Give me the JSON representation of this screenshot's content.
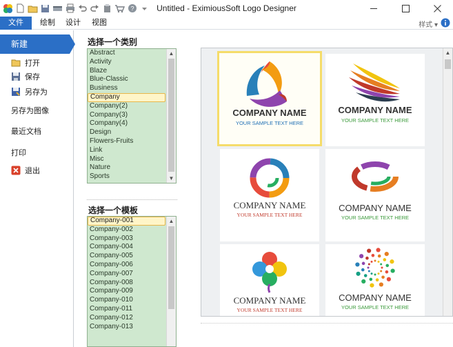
{
  "window": {
    "title": "Untitled - EximiousSoft Logo Designer"
  },
  "qat_icons": [
    "app-logo-icon",
    "new-file-icon",
    "open-folder-icon",
    "save-icon",
    "scanner-icon",
    "print-icon",
    "undo-icon",
    "redo-icon",
    "paste-icon",
    "cart-icon",
    "help-icon",
    "customize-arrow-icon"
  ],
  "ribbon": {
    "tabs": [
      "文件",
      "绘制",
      "设计",
      "视图"
    ],
    "active_tab": 0,
    "style_label": "样式",
    "accent": "#2b6fc6"
  },
  "sidebar": {
    "new_label": "新建",
    "items": [
      {
        "label": "打开",
        "icon": "open-folder-icon"
      },
      {
        "label": "保存",
        "icon": "save-icon"
      },
      {
        "label": "另存为",
        "icon": "save-as-icon"
      },
      {
        "label": "另存为图像",
        "icon": ""
      },
      {
        "label": "最近文档",
        "icon": ""
      },
      {
        "label": "打印",
        "icon": ""
      },
      {
        "label": "退出",
        "icon": "exit-icon"
      }
    ]
  },
  "category": {
    "heading": "选择一个类别",
    "items": [
      "Abstract",
      "Activity",
      "Blaze",
      "Blue-Classic",
      "Business",
      "Company",
      "Company(2)",
      "Company(3)",
      "Company(4)",
      "Design",
      "Flowers-Fruits",
      "Link",
      "Misc",
      "Nature",
      "Sports"
    ],
    "selected": 5
  },
  "template": {
    "heading": "选择一个模板",
    "items": [
      "Company-001",
      "Company-002",
      "Company-003",
      "Company-004",
      "Company-005",
      "Company-006",
      "Company-007",
      "Company-008",
      "Company-009",
      "Company-010",
      "Company-011",
      "Company-012",
      "Company-013"
    ],
    "selected": 0
  },
  "previews": [
    {
      "company": "COMPANY NAME",
      "tagline": "YOUR SAMPLE TEXT HERE",
      "tagline_color": "#1f6fb5",
      "selected": true
    },
    {
      "company": "COMPANY NAME",
      "tagline": "YOUR SAMPLE TEXT HERE",
      "tagline_color": "#3a9a3a",
      "selected": false
    },
    {
      "company": "COMPANY NAME",
      "tagline": "YOUR SAMPLE TEXT HERE",
      "tagline_color": "#c0392b",
      "selected": false
    },
    {
      "company": "COMPANY NAME",
      "tagline": "YOUR SAMPLE TEXT HERE",
      "tagline_color": "#3a9a3a",
      "selected": false
    },
    {
      "company": "COMPANY NAME",
      "tagline": "YOUR SAMPLE TEXT HERE",
      "tagline_color": "#c0392b",
      "selected": false
    },
    {
      "company": "COMPANY NAME",
      "tagline": "YOUR SAMPLE TEXT HERE",
      "tagline_color": "#3a9a3a",
      "selected": false
    }
  ]
}
